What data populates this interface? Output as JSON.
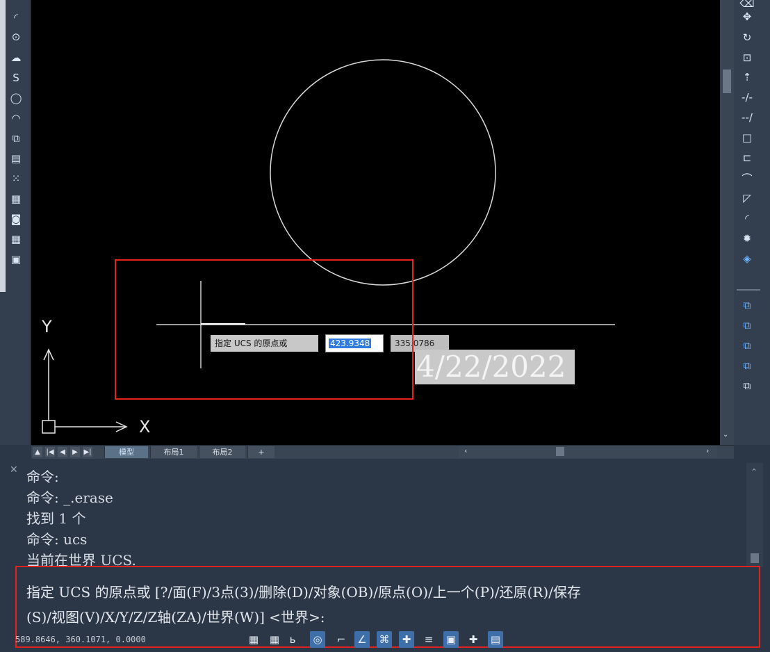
{
  "tooltip": {
    "prompt": "指定 UCS 的原点或",
    "x_value": "423.9348",
    "y_value": "335.0786"
  },
  "date_overlay": "4/22/2022",
  "axis_labels": {
    "x": "X",
    "y": "Y"
  },
  "layout_tabs": [
    "模型",
    "布局1",
    "布局2",
    "+"
  ],
  "tab_nav": [
    "▲",
    "|◀",
    "◀",
    "▶",
    "▶|"
  ],
  "command_history": [
    "命令:",
    "命令: _.erase",
    "找到 1 个",
    "命令: ucs",
    "当前在世界 UCS."
  ],
  "command_prompt": [
    "指定 UCS 的原点或 [?/面(F)/3点(3)/删除(D)/对象(OB)/原点(O)/上一个(P)/还原(R)/保存",
    "(S)/视图(V)/X/Y/Z/Z轴(ZA)/世界(W)] <世界>:"
  ],
  "status_coords": "589.8646, 360.1071, 0.0000",
  "colors": {
    "accent": "#3f6fa8",
    "highlight": "#e0231c",
    "selection": "#2f7be0"
  },
  "left_tools": [
    "arc-icon",
    "circle-center-icon",
    "cloud-icon",
    "spline-icon",
    "ellipse-icon",
    "ellipse-arc-icon",
    "insert-block-icon",
    "make-block-icon",
    "point-icon",
    "hatch-icon",
    "region-icon",
    "table-icon",
    "mtext-icon"
  ],
  "right_tools": [
    "erase-icon",
    "move-icon",
    "rotate-icon",
    "scale-icon",
    "stretch-icon",
    "trim-icon",
    "extend-icon",
    "break-icon",
    "break-at-point-icon",
    "join-icon",
    "chamfer-icon",
    "fillet-icon",
    "explode-icon",
    "properties-icon",
    "draworder-front-icon",
    "draworder-back-icon",
    "draworder-above-icon",
    "draworder-under-icon",
    "copy-prop-icon"
  ],
  "status_toggles": [
    "grid-icon",
    "snap-icon",
    "infer-icon",
    "polar-icon",
    "ortho-icon",
    "osnap-icon",
    "otrack-icon",
    "dynucs-icon",
    "lineweight-icon",
    "transparency-icon",
    "selection-cycle-icon",
    "annotation-icon"
  ]
}
